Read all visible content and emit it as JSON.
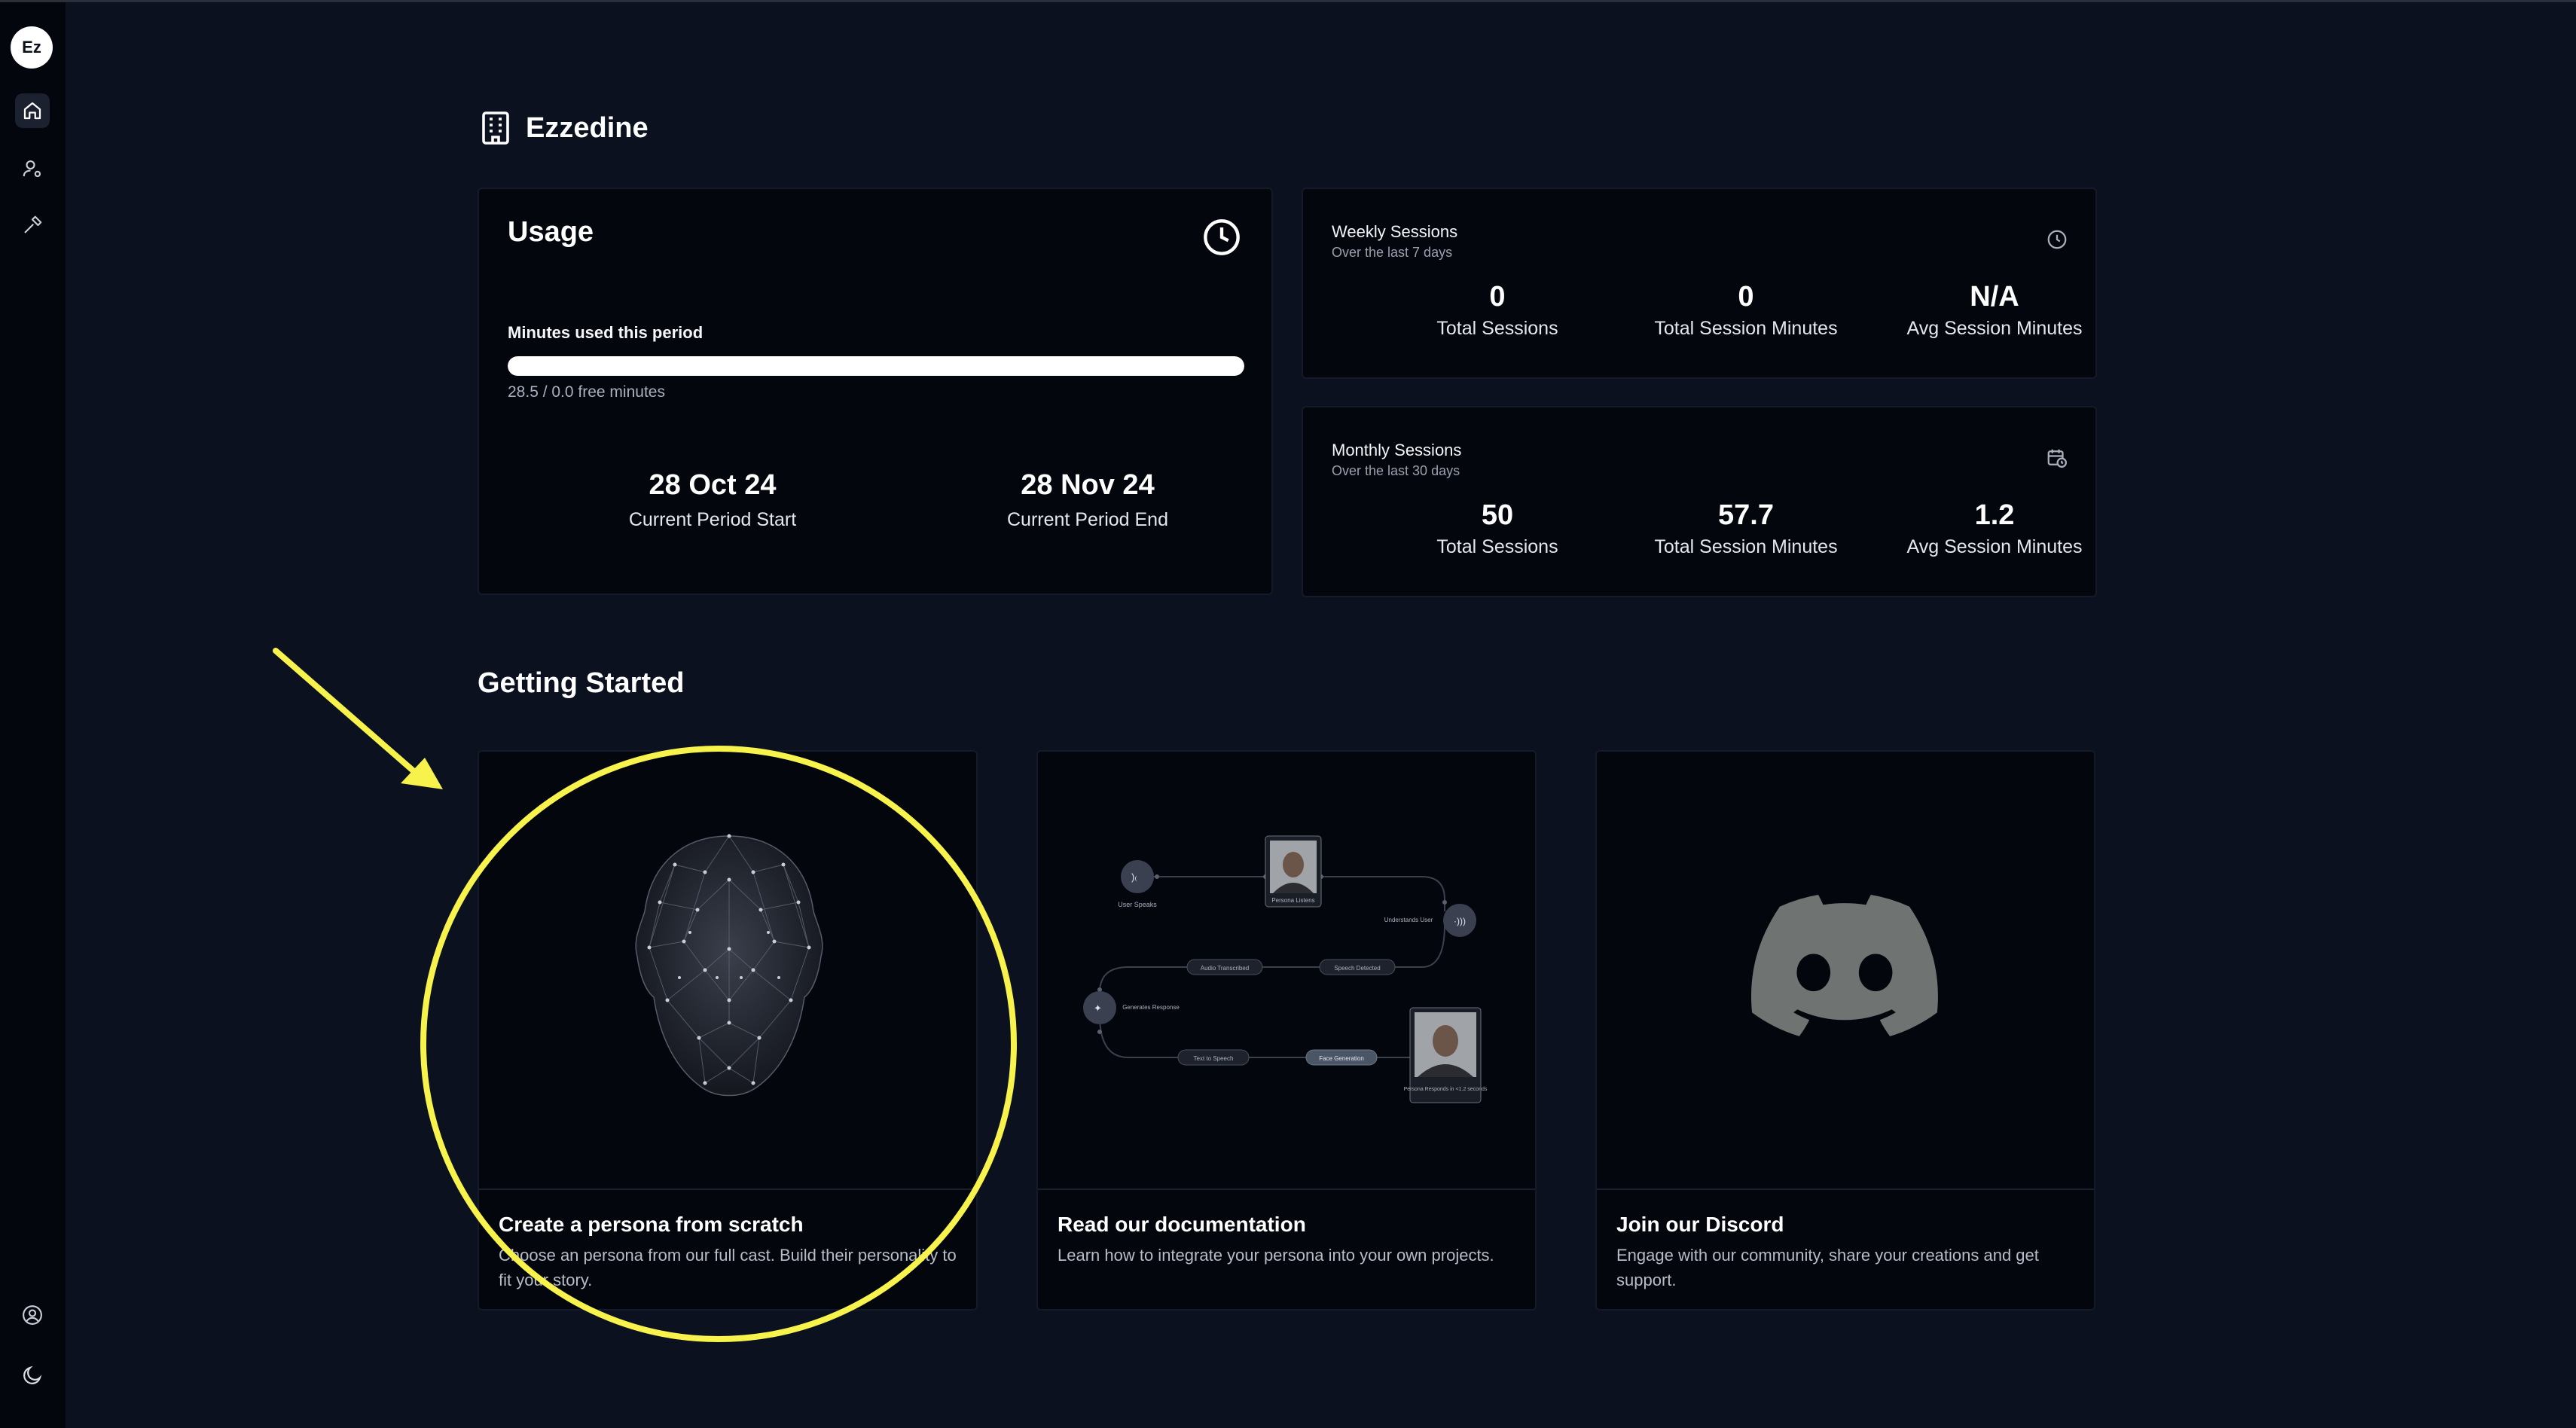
{
  "sidebar": {
    "avatar_initials": "Ez",
    "items": [
      {
        "icon": "home-icon",
        "active": true
      },
      {
        "icon": "user-settings-icon",
        "active": false
      },
      {
        "icon": "hammer-icon",
        "active": false
      }
    ],
    "bottom": [
      {
        "icon": "account-circle-icon"
      },
      {
        "icon": "moon-icon"
      }
    ]
  },
  "workspace": {
    "name": "Ezzedine",
    "icon": "building-icon"
  },
  "usage": {
    "title": "Usage",
    "minutes_label": "Minutes used this period",
    "progress_fraction": 1.0,
    "minutes_sub": "28.5 / 0.0 free minutes",
    "period_start": {
      "value": "28 Oct 24",
      "label": "Current Period Start"
    },
    "period_end": {
      "value": "28 Nov 24",
      "label": "Current Period End"
    }
  },
  "weekly": {
    "title": "Weekly Sessions",
    "subtitle": "Over the last 7 days",
    "icon": "clock-icon",
    "stats": [
      {
        "value": "0",
        "label": "Total Sessions"
      },
      {
        "value": "0",
        "label": "Total Session Minutes"
      },
      {
        "value": "N/A",
        "label": "Avg Session Minutes"
      }
    ]
  },
  "monthly": {
    "title": "Monthly Sessions",
    "subtitle": "Over the last 30 days",
    "icon": "calendar-clock-icon",
    "stats": [
      {
        "value": "50",
        "label": "Total Sessions"
      },
      {
        "value": "57.7",
        "label": "Total Session Minutes"
      },
      {
        "value": "1.2",
        "label": "Avg Session Minutes"
      }
    ]
  },
  "getting_started": {
    "title": "Getting Started",
    "cards": [
      {
        "title": "Create a persona from scratch",
        "description": "Choose an persona from our full cast. Build their personality to fit your story."
      },
      {
        "title": "Read our documentation",
        "description": "Learn how to integrate your persona into your own projects."
      },
      {
        "title": "Join our Discord",
        "description": "Engage with our community, share your creations and get support."
      }
    ]
  },
  "diagram": {
    "nodes": [
      "User Speaks",
      "Persona Listens",
      "Understands User",
      "Generates Response",
      "Persona Responds in <1.2 seconds"
    ],
    "pills": [
      "Audio Transcribed",
      "Speech Detected",
      "Text to Speech",
      "Face Generation"
    ]
  },
  "colors": {
    "annotation": "#f7f34c",
    "background": "#0c1120",
    "card": "#03060d"
  }
}
